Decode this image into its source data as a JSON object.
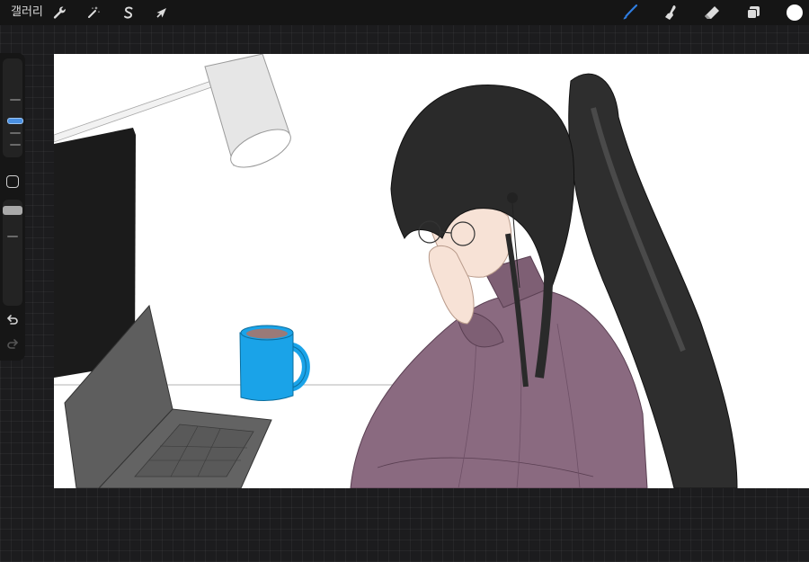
{
  "topbar": {
    "gallery_label": "갤러리",
    "left_tools": [
      {
        "name": "actions",
        "icon": "wrench-icon"
      },
      {
        "name": "adjustments",
        "icon": "magic-wand-icon"
      },
      {
        "name": "selection",
        "icon": "selection-s-icon"
      },
      {
        "name": "transform",
        "icon": "arrow-cursor-icon"
      }
    ],
    "right_tools": [
      {
        "name": "brush",
        "icon": "brush-icon",
        "active": true
      },
      {
        "name": "smudge",
        "icon": "smudge-finger-icon"
      },
      {
        "name": "eraser",
        "icon": "eraser-icon"
      },
      {
        "name": "layers",
        "icon": "layers-icon"
      }
    ],
    "current_color": "#ffffff",
    "active_color": "#2f7de1"
  },
  "sidebar": {
    "brush_size_level": 0.35,
    "brush_opacity_level": 0.1,
    "icons": [
      "modify-square-icon",
      "undo-icon",
      "redo-icon"
    ]
  },
  "canvas": {
    "background": "#ffffff",
    "colors": {
      "mug": "#1aa3e8",
      "sweater": "#8a6a80",
      "hair": "#2a2a2a",
      "laptop": "#5e5e5e",
      "lamp": "#e6e6e6",
      "monitor": "#1b1b1b",
      "skin": "#f7e2d6"
    }
  }
}
